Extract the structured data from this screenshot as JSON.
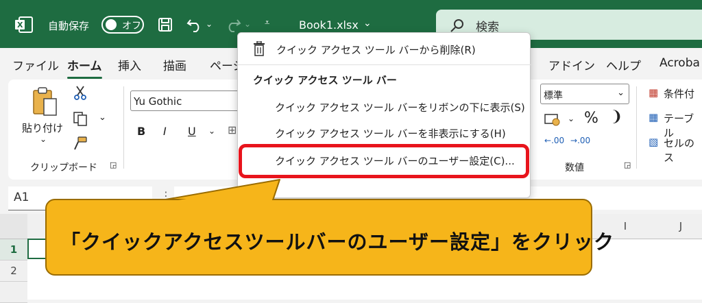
{
  "titlebar": {
    "autosave_label": "自動保存",
    "toggle_label": "オフ",
    "filename": "Book1.xlsx",
    "search_placeholder": "検索",
    "accent_color": "#1e6c41"
  },
  "menu_tabs": [
    "ファイル",
    "ホーム",
    "挿入",
    "描画",
    "ページ",
    "アドイン",
    "ヘルプ",
    "Acroba"
  ],
  "ribbon": {
    "paste_label": "貼り付け",
    "clipboard_group": "クリップボード",
    "font_name": "Yu Gothic",
    "bold": "B",
    "italic": "I",
    "underline": "U",
    "number_format": "標準",
    "percent": "%",
    "comma": "❩",
    "dec_inc": ".00",
    "dec_dec": ".00",
    "number_group": "数値",
    "conditional": "条件付",
    "table": "テーブル",
    "cell": "セルのス"
  },
  "namebox": "A1",
  "grid": {
    "rows": [
      "1",
      "2"
    ],
    "col_i": "I",
    "col_j": "J"
  },
  "dropdown": {
    "remove": "クイック アクセス ツール バーから削除(R)",
    "heading": "クイック アクセス ツール バー",
    "show_below": "クイック アクセス ツール バーをリボンの下に表示(S)",
    "hide": "クイック アクセス ツール バーを非表示にする(H)",
    "customize": "クイック アクセス ツール バーのユーザー設定(C)..."
  },
  "callout": "「クイックアクセスツールバーのユーザー設定」をクリック"
}
